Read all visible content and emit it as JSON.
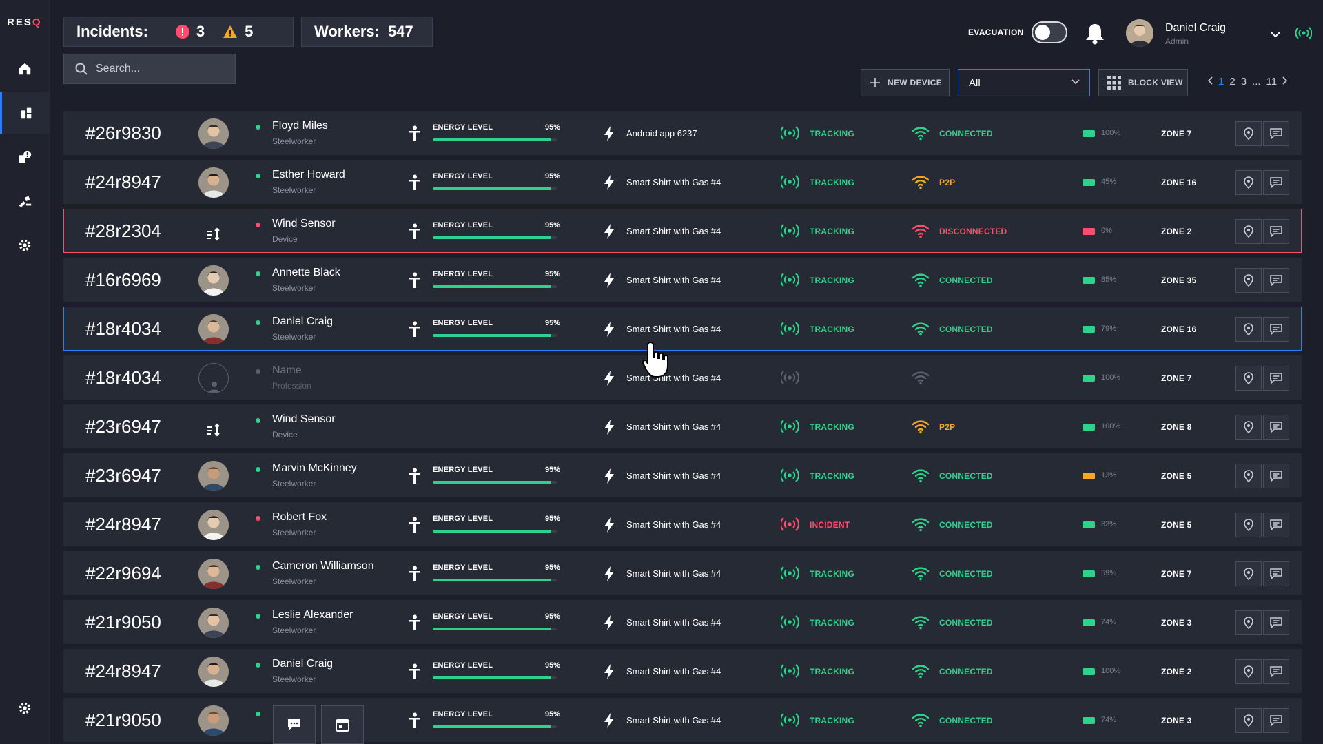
{
  "app": {
    "logo_text": "RES",
    "logo_q": "Q"
  },
  "sidebar": {
    "items": [
      {
        "icon": "home-icon"
      },
      {
        "icon": "devices-icon",
        "active": true
      },
      {
        "icon": "alerts-icon"
      },
      {
        "icon": "tools-icon"
      },
      {
        "icon": "settings-icon"
      }
    ],
    "bottom_icon": "settings-icon"
  },
  "header": {
    "incidents_label": "Incidents:",
    "incidents_critical": "3",
    "incidents_warning": "5",
    "workers_label": "Workers:",
    "workers_count": "547",
    "evacuation_label": "EVACUATION",
    "evacuation_on": false,
    "user_name": "Daniel Craig",
    "user_role": "Admin"
  },
  "search": {
    "placeholder": "Search..."
  },
  "toolbar": {
    "new_device_label": "NEW DEVICE",
    "filter_value": "All",
    "block_view_label": "BLOCK VIEW",
    "pager": [
      "1",
      "2",
      "3",
      "...",
      "11"
    ],
    "current_page": "1"
  },
  "columns": {
    "energy_label": "ENERGY LEVEL"
  },
  "rows": [
    {
      "id": "#26r9830",
      "kind": "person",
      "name": "Floyd Miles",
      "profession": "Steelworker",
      "status_dot": "green",
      "energy_pct": "95%",
      "energy_value": 95,
      "device": "Android app 6237",
      "tracking": "TRACKING",
      "tracking_color": "green",
      "connection": "CONNECTED",
      "connection_color": "green",
      "battery_pct": "100%",
      "battery_value": 100,
      "battery_color": "green",
      "zone": "ZONE 7",
      "state": "normal"
    },
    {
      "id": "#24r8947",
      "kind": "person",
      "name": "Esther Howard",
      "profession": "Steelworker",
      "status_dot": "green",
      "energy_pct": "95%",
      "energy_value": 95,
      "device": "Smart Shirt with Gas #4",
      "tracking": "TRACKING",
      "tracking_color": "green",
      "connection": "P2P",
      "connection_color": "orange",
      "battery_pct": "45%",
      "battery_value": 45,
      "battery_color": "green",
      "zone": "ZONE 16",
      "state": "normal"
    },
    {
      "id": "#28r2304",
      "kind": "sensor",
      "name": "Wind Sensor",
      "profession": "Device",
      "status_dot": "red",
      "energy_pct": "95%",
      "energy_value": 95,
      "device": "Smart Shirt with Gas #4",
      "tracking": "TRACKING",
      "tracking_color": "green",
      "connection": "DISCONNECTED",
      "connection_color": "red",
      "battery_pct": "0%",
      "battery_value": 0,
      "battery_color": "red",
      "zone": "ZONE 2",
      "state": "alert"
    },
    {
      "id": "#16r6969",
      "kind": "person",
      "name": "Annette Black",
      "profession": "Steelworker",
      "status_dot": "green",
      "energy_pct": "95%",
      "energy_value": 95,
      "device": "Smart Shirt with Gas #4",
      "tracking": "TRACKING",
      "tracking_color": "green",
      "connection": "CONNECTED",
      "connection_color": "green",
      "battery_pct": "85%",
      "battery_value": 85,
      "battery_color": "green",
      "zone": "ZONE 35",
      "state": "normal"
    },
    {
      "id": "#18r4034",
      "kind": "person",
      "name": "Daniel Craig",
      "profession": "Steelworker",
      "status_dot": "green",
      "energy_pct": "95%",
      "energy_value": 95,
      "device": "Smart Shirt with Gas #4",
      "tracking": "TRACKING",
      "tracking_color": "green",
      "connection": "CONNECTED",
      "connection_color": "green",
      "battery_pct": "79%",
      "battery_value": 79,
      "battery_color": "green",
      "zone": "ZONE 16",
      "state": "selected"
    },
    {
      "id": "#18r4034",
      "kind": "empty",
      "name": "Name",
      "profession": "Profession",
      "status_dot": "grey",
      "energy_pct": "",
      "energy_value": null,
      "device": "Smart Shirt with Gas #4",
      "tracking": "",
      "tracking_color": "grey",
      "connection": "",
      "connection_color": "grey",
      "battery_pct": "100%",
      "battery_value": 100,
      "battery_color": "green",
      "zone": "ZONE 7",
      "state": "normal"
    },
    {
      "id": "#23r6947",
      "kind": "sensor",
      "name": "Wind Sensor",
      "profession": "Device",
      "status_dot": "green",
      "energy_pct": "",
      "energy_value": null,
      "device": "Smart Shirt with Gas #4",
      "tracking": "TRACKING",
      "tracking_color": "green",
      "connection": "P2P",
      "connection_color": "orange",
      "battery_pct": "100%",
      "battery_value": 100,
      "battery_color": "green",
      "zone": "ZONE 8",
      "state": "normal"
    },
    {
      "id": "#23r6947",
      "kind": "person",
      "name": "Marvin McKinney",
      "profession": "Steelworker",
      "status_dot": "green",
      "energy_pct": "95%",
      "energy_value": 95,
      "device": "Smart Shirt with Gas #4",
      "tracking": "TRACKING",
      "tracking_color": "green",
      "connection": "CONNECTED",
      "connection_color": "green",
      "battery_pct": "13%",
      "battery_value": 13,
      "battery_color": "orange",
      "zone": "ZONE 5",
      "state": "normal"
    },
    {
      "id": "#24r8947",
      "kind": "person",
      "name": "Robert Fox",
      "profession": "Steelworker",
      "status_dot": "red",
      "energy_pct": "95%",
      "energy_value": 95,
      "device": "Smart Shirt with Gas #4",
      "tracking": "INCIDENT",
      "tracking_color": "red",
      "connection": "CONNECTED",
      "connection_color": "green",
      "battery_pct": "83%",
      "battery_value": 83,
      "battery_color": "green",
      "zone": "ZONE 5",
      "state": "normal"
    },
    {
      "id": "#22r9694",
      "kind": "person",
      "name": "Cameron Williamson",
      "profession": "Steelworker",
      "status_dot": "green",
      "energy_pct": "95%",
      "energy_value": 95,
      "device": "Smart Shirt with Gas #4",
      "tracking": "TRACKING",
      "tracking_color": "green",
      "connection": "CONNECTED",
      "connection_color": "green",
      "battery_pct": "59%",
      "battery_value": 59,
      "battery_color": "green",
      "zone": "ZONE 7",
      "state": "normal"
    },
    {
      "id": "#21r9050",
      "kind": "person",
      "name": "Leslie Alexander",
      "profession": "Steelworker",
      "status_dot": "green",
      "energy_pct": "95%",
      "energy_value": 95,
      "device": "Smart Shirt with Gas #4",
      "tracking": "TRACKING",
      "tracking_color": "green",
      "connection": "CONNECTED",
      "connection_color": "green",
      "battery_pct": "74%",
      "battery_value": 74,
      "battery_color": "green",
      "zone": "ZONE 3",
      "state": "normal"
    },
    {
      "id": "#24r8947",
      "kind": "person",
      "name": "Daniel Craig",
      "profession": "Steelworker",
      "status_dot": "green",
      "energy_pct": "95%",
      "energy_value": 95,
      "device": "Smart Shirt with Gas #4",
      "tracking": "TRACKING",
      "tracking_color": "green",
      "connection": "CONNECTED",
      "connection_color": "green",
      "battery_pct": "100%",
      "battery_value": 100,
      "battery_color": "green",
      "zone": "ZONE 2",
      "state": "normal"
    },
    {
      "id": "#21r9050",
      "kind": "person",
      "name": "",
      "profession": "",
      "status_dot": "green",
      "energy_pct": "95%",
      "energy_value": 95,
      "device": "Smart Shirt with Gas #4",
      "tracking": "TRACKING",
      "tracking_color": "green",
      "connection": "CONNECTED",
      "connection_color": "green",
      "battery_pct": "74%",
      "battery_value": 74,
      "battery_color": "green",
      "zone": "ZONE 3",
      "state": "normal"
    }
  ],
  "floating_actions": [
    {
      "icon": "chat-icon"
    },
    {
      "icon": "calendar-icon"
    }
  ],
  "colors": {
    "accent": "#2f7bff",
    "green": "#2ed38b",
    "red": "#ff4d6d",
    "orange": "#f5a623",
    "background": "#1c1f29",
    "row": "#262a35"
  }
}
